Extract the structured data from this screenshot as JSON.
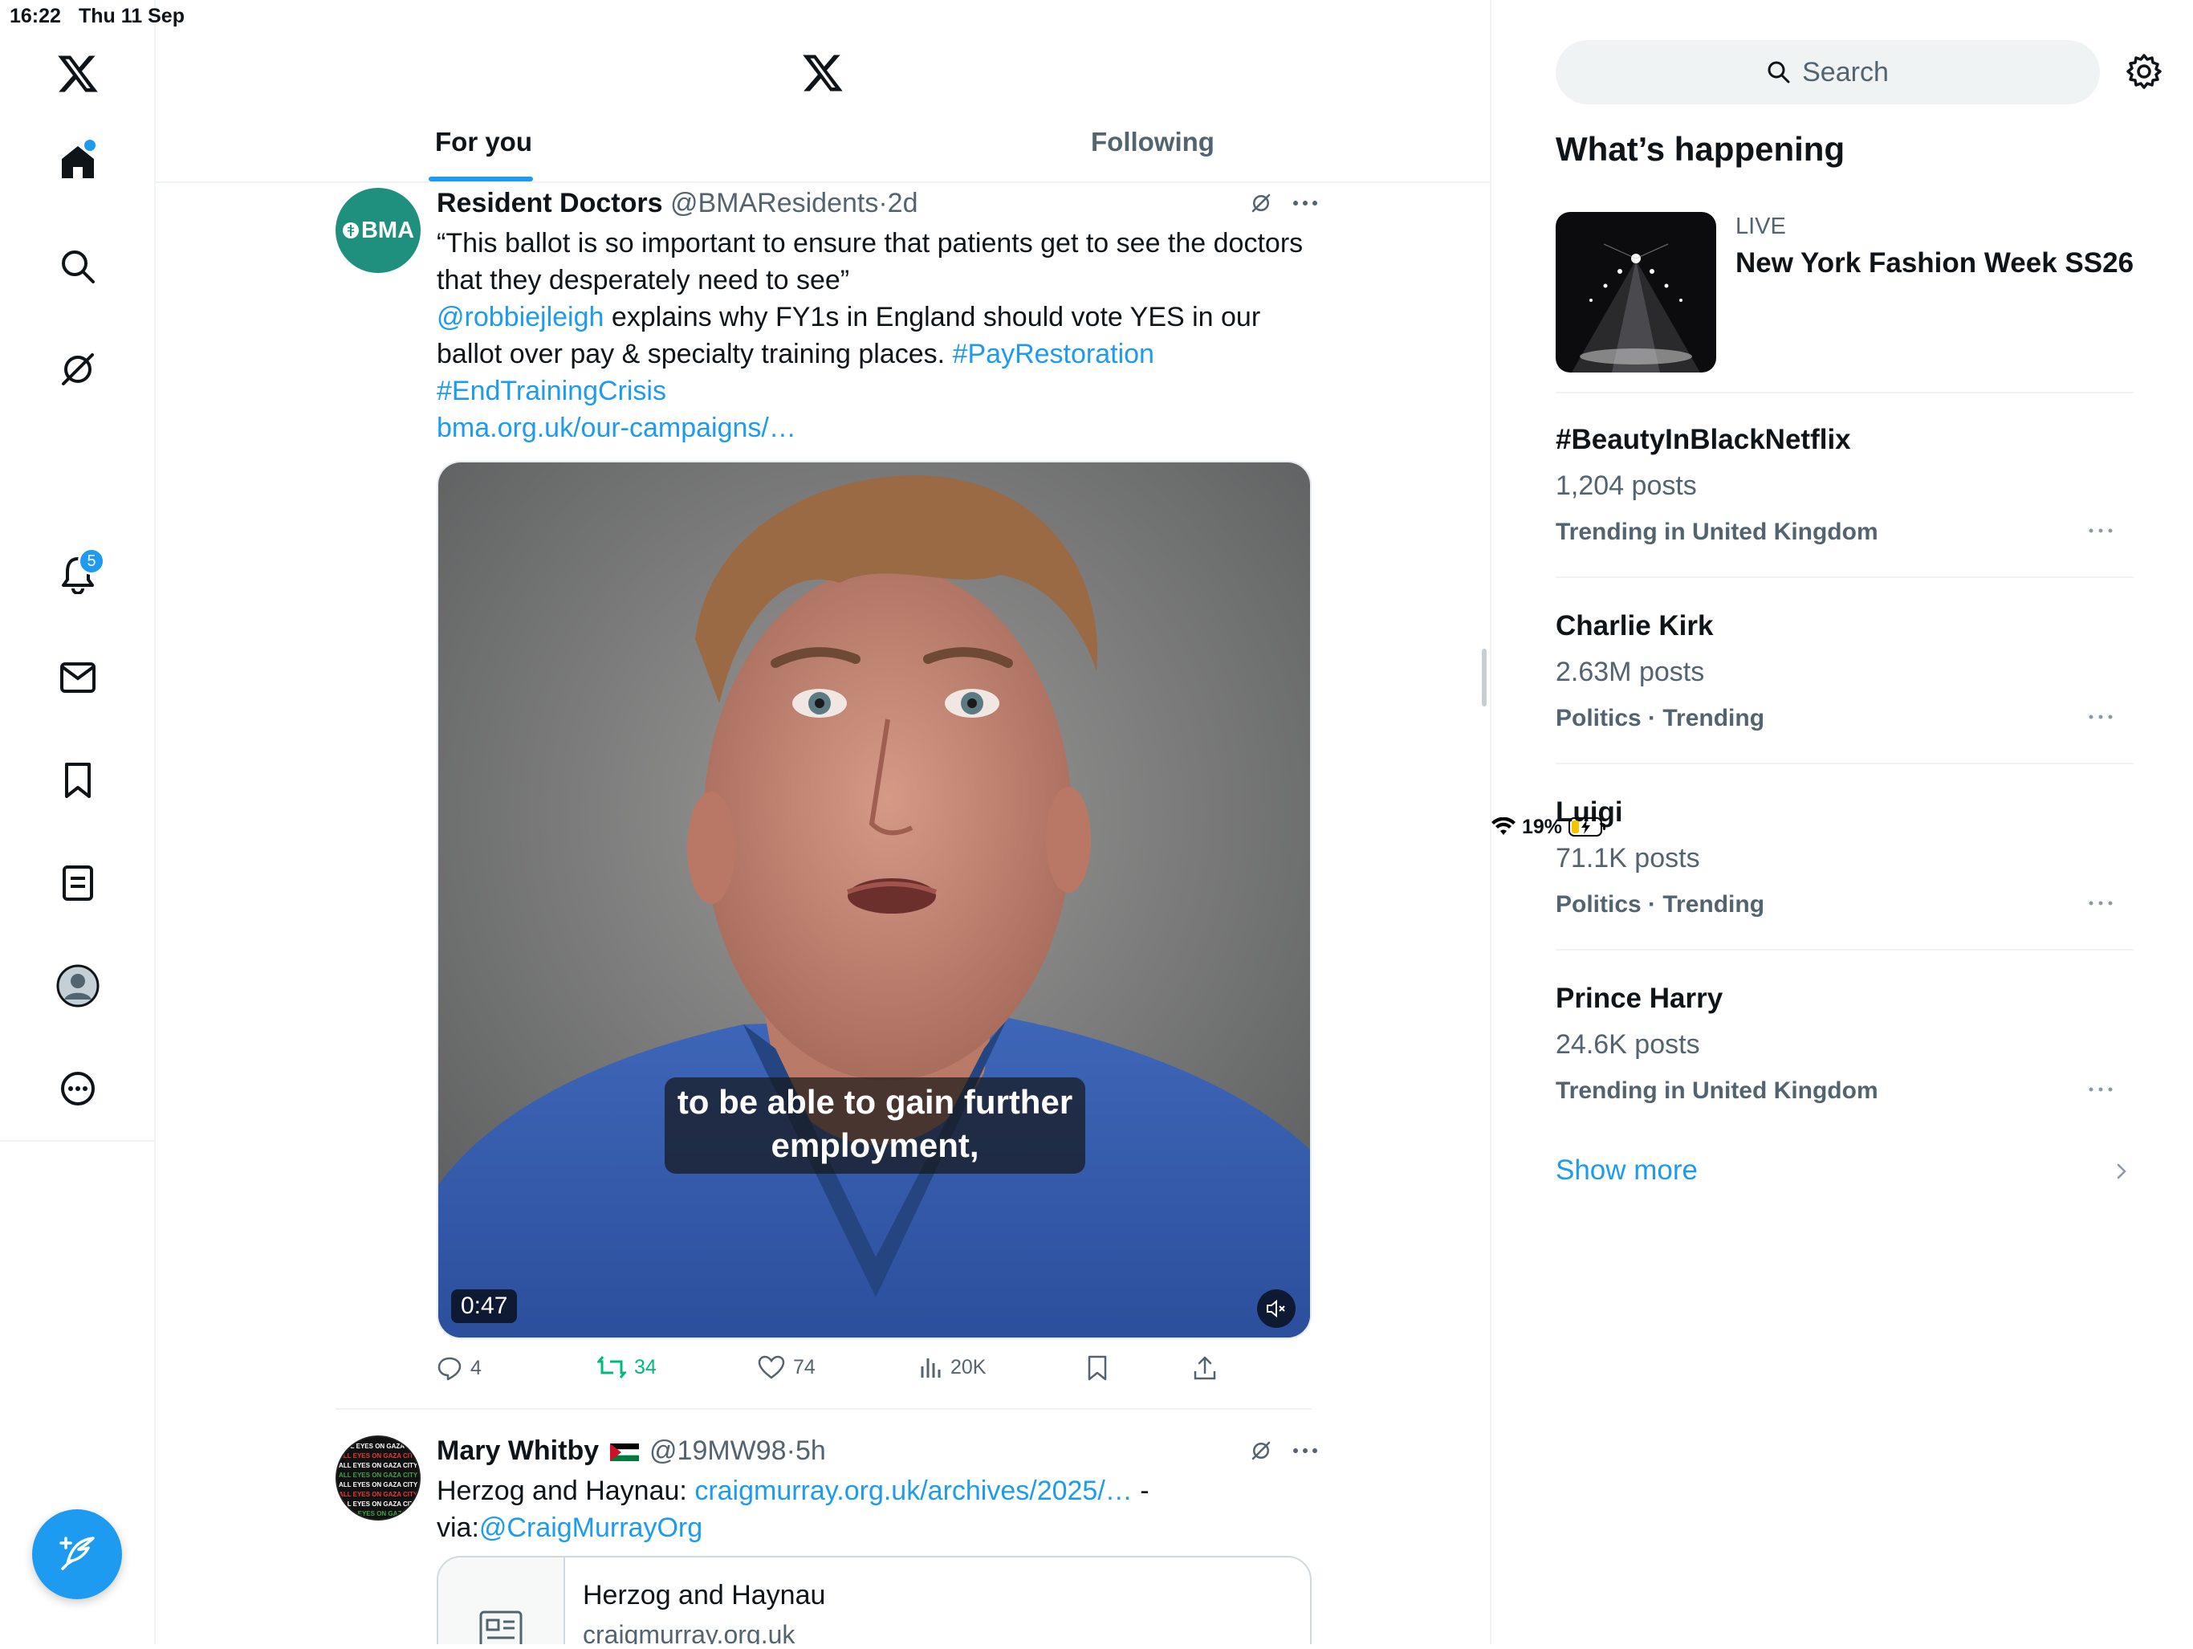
{
  "status_bar": {
    "time": "16:22",
    "date": "Thu 11 Sep",
    "battery": "19%"
  },
  "nav": {
    "notifications_badge": "5",
    "items": [
      "home",
      "explore",
      "grok",
      "videos",
      "notifications",
      "messages",
      "bookmarks",
      "lists",
      "profile",
      "more"
    ]
  },
  "header": {
    "tabs": [
      {
        "label": "For you",
        "active": true
      },
      {
        "label": "Following",
        "active": false
      }
    ]
  },
  "tweets": [
    {
      "avatar_text": "BMA",
      "name": "Resident Doctors",
      "handle": "@BMAResidents",
      "dot": "·",
      "time": "2d",
      "quote": "“This ballot is so important to ensure that patients get to see the doctors that they desperately need to see”",
      "mention": "@robbiejleigh",
      "body_mid": " explains why FY1s in England should vote YES in our ballot over pay & specialty training places. ",
      "hashtag1": "#PayRestoration",
      "hashtag2": "#EndTrainingCrisis",
      "link": "bma.org.uk/our-campaigns/…",
      "video": {
        "caption": "to be able to gain further employment,",
        "duration": "0:47"
      },
      "stats": {
        "replies": "4",
        "reposts": "34",
        "likes": "74",
        "views": "20K"
      }
    },
    {
      "name": "Mary Whitby",
      "handle": "@19MW98",
      "dot": "·",
      "time": "5h",
      "text_prefix": "Herzog and Haynau: ",
      "link": "craigmurray.org.uk/archives/2025/…",
      "text_suffix": " -",
      "via_prefix": "via:",
      "via_mention": "@CraigMurrayOrg",
      "avatar_text": "ALL EYES ON GAZA CITY",
      "card": {
        "title": "Herzog and Haynau",
        "domain": "craigmurray.org.uk"
      }
    }
  ],
  "sidebar": {
    "search_placeholder": "Search",
    "section_title": "What’s happening",
    "live": {
      "label": "LIVE",
      "title": "New York Fashion Week SS26"
    },
    "trends": [
      {
        "name": "#BeautyInBlackNetflix",
        "posts": "1,204 posts",
        "context": "Trending in United Kingdom"
      },
      {
        "name": "Charlie Kirk",
        "posts": "2.63M posts",
        "context": "Politics · Trending"
      },
      {
        "name": "Luigi",
        "posts": "71.1K posts",
        "context": "Politics · Trending"
      },
      {
        "name": "Prince Harry",
        "posts": "24.6K posts",
        "context": "Trending in United Kingdom"
      }
    ],
    "show_more": "Show more"
  },
  "colors": {
    "accent": "#1d9bf0",
    "text": "#0f1419",
    "muted": "#536471",
    "repost": "#00ba7c",
    "bma_green": "#1f8f7e"
  }
}
